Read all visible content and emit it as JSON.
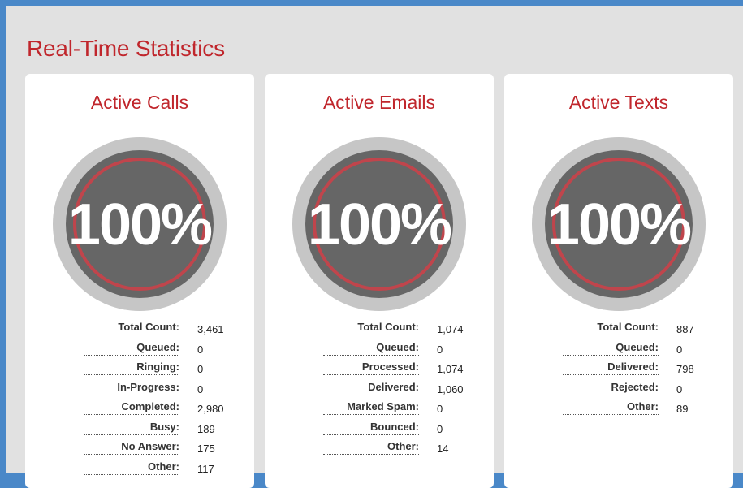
{
  "page": {
    "title": "Real-Time Statistics"
  },
  "colors": {
    "accent": "#c0262c",
    "gauge_outer": "#c6c6c6",
    "gauge_inner": "#666666",
    "gauge_ring": "#c0454c"
  },
  "cards": [
    {
      "title": "Active Calls",
      "gauge_value": "100%",
      "gauge_fraction": 1.0,
      "stats": [
        {
          "label": "Total Count:",
          "value": "3,461"
        },
        {
          "label": "Queued:",
          "value": "0"
        },
        {
          "label": "Ringing:",
          "value": "0"
        },
        {
          "label": "In-Progress:",
          "value": "0"
        },
        {
          "label": "Completed:",
          "value": "2,980"
        },
        {
          "label": "Busy:",
          "value": "189"
        },
        {
          "label": "No Answer:",
          "value": "175"
        },
        {
          "label": "Other:",
          "value": "117"
        }
      ]
    },
    {
      "title": "Active Emails",
      "gauge_value": "100%",
      "gauge_fraction": 1.0,
      "stats": [
        {
          "label": "Total Count:",
          "value": "1,074"
        },
        {
          "label": "Queued:",
          "value": "0"
        },
        {
          "label": "Processed:",
          "value": "1,074"
        },
        {
          "label": "Delivered:",
          "value": "1,060"
        },
        {
          "label": "Marked Spam:",
          "value": "0"
        },
        {
          "label": "Bounced:",
          "value": "0"
        },
        {
          "label": "Other:",
          "value": "14"
        }
      ]
    },
    {
      "title": "Active Texts",
      "gauge_value": "100%",
      "gauge_fraction": 1.0,
      "stats": [
        {
          "label": "Total Count:",
          "value": "887"
        },
        {
          "label": "Queued:",
          "value": "0"
        },
        {
          "label": "Delivered:",
          "value": "798"
        },
        {
          "label": "Rejected:",
          "value": "0"
        },
        {
          "label": "Other:",
          "value": "89"
        }
      ]
    }
  ]
}
